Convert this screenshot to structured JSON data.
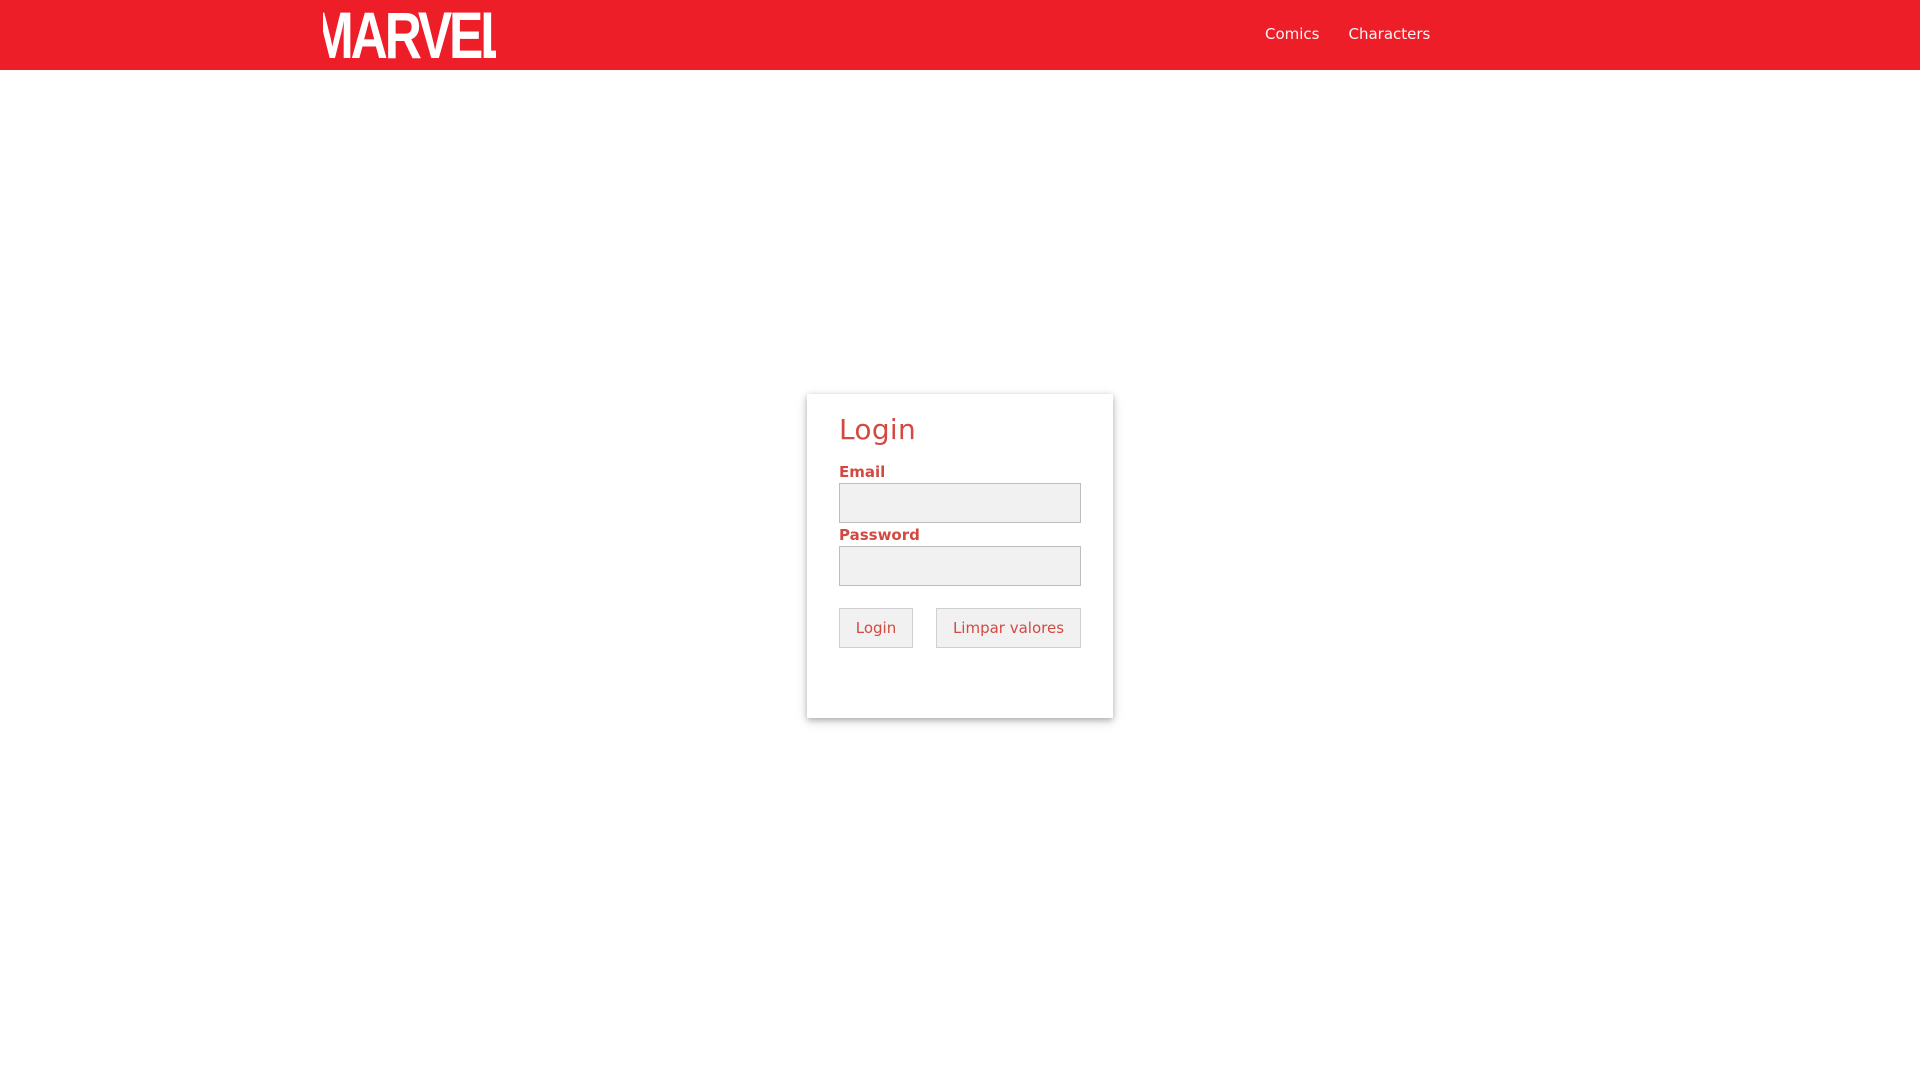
{
  "brand": {
    "logo_text": "MARVEL",
    "accent_color": "#ee1e28"
  },
  "nav": {
    "links": [
      {
        "label": "Comics"
      },
      {
        "label": "Characters"
      }
    ]
  },
  "login_form": {
    "title": "Login",
    "email_label": "Email",
    "email_value": "",
    "password_label": "Password",
    "password_value": "",
    "login_button": "Login",
    "clear_button": "Limpar valores",
    "text_color": "#d24a42"
  }
}
